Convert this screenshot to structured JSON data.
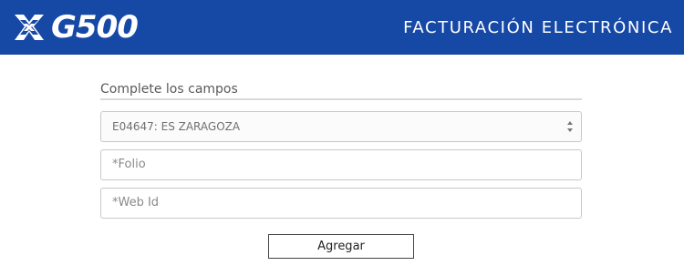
{
  "header": {
    "logo_text": "G500",
    "title": "FACTURACIÓN ELECTRÓNICA",
    "background_color": "#1648a6"
  },
  "form": {
    "heading": "Complete los campos",
    "station_select": {
      "selected": "E04647: ES ZARAGOZA"
    },
    "folio": {
      "placeholder": "*Folio",
      "value": ""
    },
    "web_id": {
      "placeholder": "*Web Id",
      "value": ""
    },
    "submit_label": "Agregar"
  },
  "icons": {
    "logo": "g500-logo-icon",
    "select_arrows": "updown-arrows-icon"
  }
}
